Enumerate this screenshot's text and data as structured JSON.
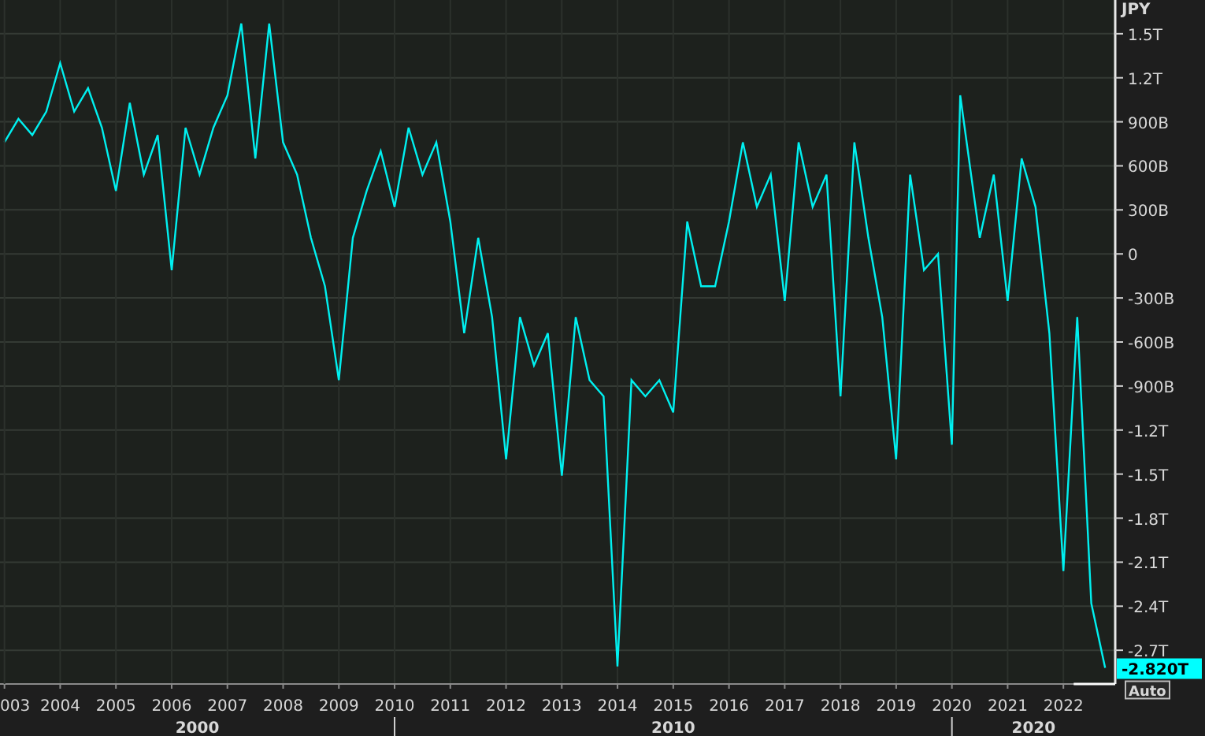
{
  "chart": {
    "chart_data": {
      "type": "line",
      "ylabel": "JPY",
      "grid": true,
      "x": [
        2003.0,
        2003.25,
        2003.5,
        2003.75,
        2004.0,
        2004.25,
        2004.5,
        2004.75,
        2005.0,
        2005.25,
        2005.5,
        2005.75,
        2006.0,
        2006.25,
        2006.5,
        2006.75,
        2007.0,
        2007.25,
        2007.5,
        2007.75,
        2008.0,
        2008.25,
        2008.5,
        2008.75,
        2009.0,
        2009.25,
        2009.5,
        2009.75,
        2010.0,
        2010.25,
        2010.5,
        2010.75,
        2011.0,
        2011.25,
        2011.5,
        2011.75,
        2012.0,
        2012.25,
        2012.5,
        2012.75,
        2013.0,
        2013.25,
        2013.5,
        2013.75,
        2014.0,
        2014.25,
        2014.5,
        2014.75,
        2015.0,
        2015.25,
        2015.5,
        2015.75,
        2016.0,
        2016.25,
        2016.5,
        2016.75,
        2017.0,
        2017.25,
        2017.5,
        2017.75,
        2018.0,
        2018.25,
        2018.5,
        2018.75,
        2019.0,
        2019.25,
        2019.5,
        2019.75,
        2020.0,
        2020.15,
        2020.5,
        2020.75,
        2021.0,
        2021.25,
        2021.5,
        2021.75,
        2022.0,
        2022.25,
        2022.5,
        2022.75
      ],
      "series": [
        {
          "color": "#00f0f0",
          "values": [
            760000000000.0,
            920000000000.0,
            810000000000.0,
            970000000000.0,
            1300000000000.0,
            970000000000.0,
            1130000000000.0,
            860000000000.0,
            430000000000.0,
            1030000000000.0,
            540000000000.0,
            810000000000.0,
            -110000000000.0,
            860000000000.0,
            540000000000.0,
            860000000000.0,
            1080000000000.0,
            1570000000000.0,
            650000000000.0,
            1570000000000.0,
            760000000000.0,
            540000000000.0,
            110000000000.0,
            -220000000000.0,
            -860000000000.0,
            110000000000.0,
            430000000000.0,
            700000000000.0,
            320000000000.0,
            860000000000.0,
            540000000000.0,
            760000000000.0,
            220000000000.0,
            -540000000000.0,
            110000000000.0,
            -430000000000.0,
            -1400000000000.0,
            -430000000000.0,
            -760000000000.0,
            -540000000000.0,
            -1510000000000.0,
            -430000000000.0,
            -860000000000.0,
            -970000000000.0,
            -2810000000000.0,
            -860000000000.0,
            -970000000000.0,
            -860000000000.0,
            -1080000000000.0,
            220000000000.0,
            -220000000000.0,
            -220000000000.0,
            220000000000.0,
            760000000000.0,
            320000000000.0,
            540000000000.0,
            -320000000000.0,
            760000000000.0,
            320000000000.0,
            540000000000.0,
            -970000000000.0,
            760000000000.0,
            110000000000.0,
            -430000000000.0,
            -1400000000000.0,
            540000000000.0,
            -110000000000.0,
            0,
            -1300000000000.0,
            1080000000000.0,
            110000000000.0,
            540000000000.0,
            -320000000000.0,
            650000000000.0,
            320000000000.0,
            -540000000000.0,
            -2160000000000.0,
            -430000000000.0,
            -2380000000000.0,
            -2820000000000.0
          ]
        }
      ],
      "xlim": [
        2002.92,
        2022.93
      ],
      "ylim": [
        -2930000000000.0,
        1730000000000.0
      ],
      "xticks": [
        2004,
        2005,
        2006,
        2007,
        2008,
        2009,
        2010,
        2011,
        2012,
        2013,
        2014,
        2015,
        2016,
        2017,
        2018,
        2019,
        2020,
        2021,
        2022
      ],
      "yticks": [
        {
          "value": 1500000000000.0,
          "label": "1.5T"
        },
        {
          "value": 1200000000000.0,
          "label": "1.2T"
        },
        {
          "value": 900000000000.0,
          "label": "900B"
        },
        {
          "value": 600000000000.0,
          "label": "600B"
        },
        {
          "value": 300000000000.0,
          "label": "300B"
        },
        0,
        {
          "value": -300000000000.0,
          "label": "-300B"
        },
        {
          "value": -600000000000.0,
          "label": "-600B"
        },
        {
          "value": -900000000000.0,
          "label": "-900B"
        },
        {
          "value": -1200000000000.0,
          "label": "-1.2T"
        },
        {
          "value": -1500000000000.0,
          "label": "-1.5T"
        },
        {
          "value": -1800000000000.0,
          "label": "-1.8T"
        },
        {
          "value": -2100000000000.0,
          "label": "-2.1T"
        },
        {
          "value": -2400000000000.0,
          "label": "-2.4T"
        },
        {
          "value": -2700000000000.0,
          "label": "-2.7T"
        }
      ]
    },
    "decades": [
      "2000",
      "2010",
      "2020"
    ],
    "edge_tick_label": "003",
    "last_value": "-2.820T",
    "scale_button": "Auto"
  }
}
